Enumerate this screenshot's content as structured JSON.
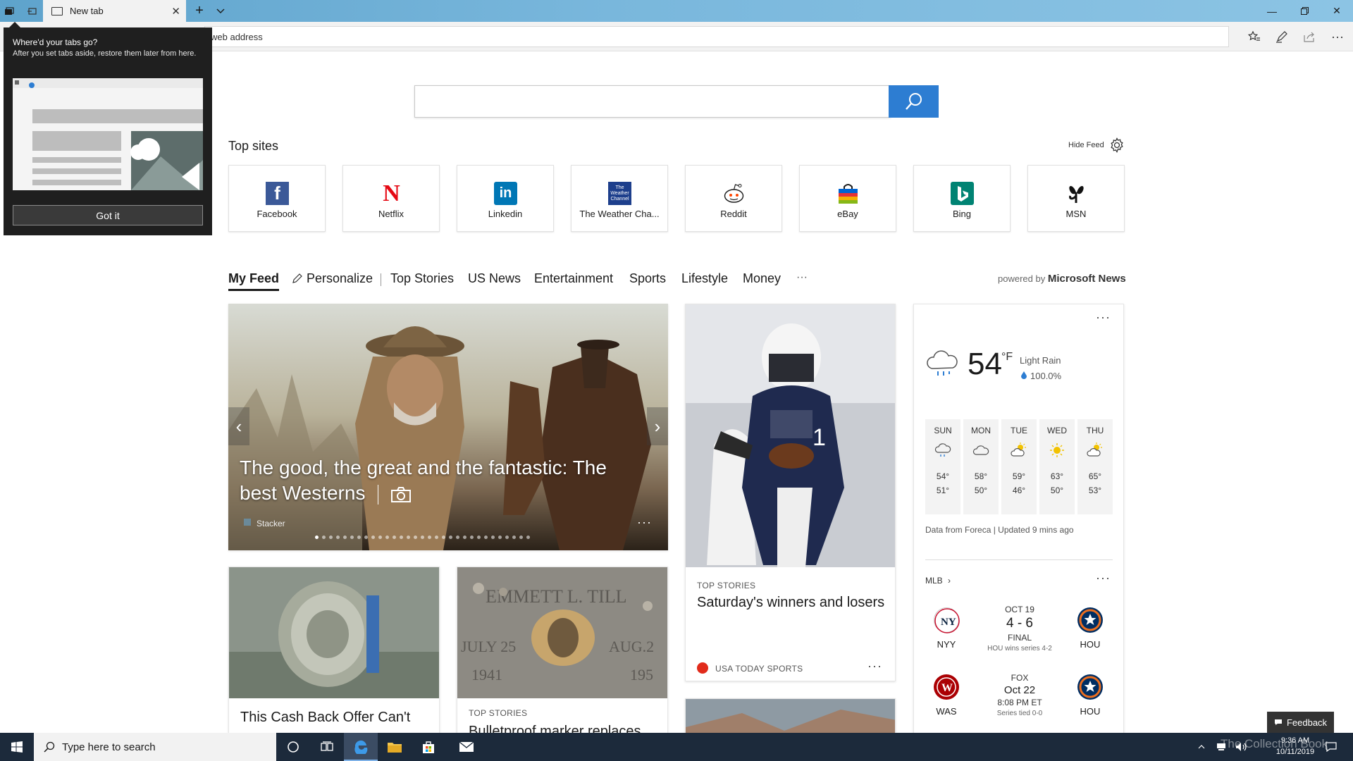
{
  "browser": {
    "tab_title": "New tab",
    "address_placeholder": "Search or enter web address",
    "address_visible": "web address"
  },
  "popup": {
    "title": "Where'd your tabs go?",
    "body": "After you set tabs aside, restore them later from here.",
    "button": "Got it"
  },
  "topsites": {
    "title": "Top sites",
    "hide_feed": "Hide Feed",
    "sites": [
      {
        "label": "Facebook",
        "icon": "facebook-icon",
        "color": "#3b5998"
      },
      {
        "label": "Netflix",
        "icon": "netflix-icon",
        "color": "#e50914"
      },
      {
        "label": "Linkedin",
        "icon": "linkedin-icon",
        "color": "#0077b5"
      },
      {
        "label": "The Weather Cha...",
        "icon": "weather-channel-icon",
        "color": "#1d3f8c"
      },
      {
        "label": "Reddit",
        "icon": "reddit-icon",
        "color": "#ff4500"
      },
      {
        "label": "eBay",
        "icon": "ebay-icon",
        "color": "#86b817"
      },
      {
        "label": "Bing",
        "icon": "bing-icon",
        "color": "#008373"
      },
      {
        "label": "MSN",
        "icon": "msn-icon",
        "color": "#111111"
      }
    ]
  },
  "feed_nav": {
    "items": [
      "My Feed",
      "Personalize",
      "Top Stories",
      "US News",
      "Entertainment",
      "Sports",
      "Lifestyle",
      "Money",
      "···"
    ],
    "powered_prefix": "powered by",
    "powered_brand": "Microsoft News"
  },
  "hero": {
    "title": "The good, the great and the fantastic: The best Westerns",
    "source": "Stacker",
    "more": "···"
  },
  "story_sports": {
    "label": "TOP STORIES",
    "title": "Saturday's winners and losers",
    "source": "USA TODAY SPORTS",
    "more": "···"
  },
  "story_cash": {
    "title": "This Cash Back Offer Can't"
  },
  "story_marker": {
    "label": "TOP STORIES",
    "title": "Bulletproof marker replaces"
  },
  "weather": {
    "temp": "54",
    "unit": "°F",
    "condition": "Light Rain",
    "precip": "100.0%",
    "more": "···",
    "forecast": [
      {
        "day": "SUN",
        "hi": "54°",
        "lo": "51°",
        "icon": "rain-cloud-icon"
      },
      {
        "day": "MON",
        "hi": "58°",
        "lo": "50°",
        "icon": "cloud-icon"
      },
      {
        "day": "TUE",
        "hi": "59°",
        "lo": "46°",
        "icon": "partly-sunny-icon"
      },
      {
        "day": "WED",
        "hi": "63°",
        "lo": "50°",
        "icon": "sun-icon"
      },
      {
        "day": "THU",
        "hi": "65°",
        "lo": "53°",
        "icon": "partly-sunny-icon"
      }
    ],
    "footer": "Data from Foreca | Updated 9 mins ago"
  },
  "mlb": {
    "title": "MLB",
    "more": "···",
    "games": [
      {
        "away": "NYY",
        "home": "HOU",
        "line1": "OCT 19",
        "score": "4 - 6",
        "status": "FINAL",
        "note": "HOU wins series 4-2"
      },
      {
        "away": "WAS",
        "home": "HOU",
        "line1": "FOX",
        "score": "Oct 22",
        "status": "8:08 PM ET",
        "note": "Series tied 0-0"
      }
    ]
  },
  "feedback": "Feedback",
  "taskbar": {
    "search_placeholder": "Type here to search",
    "time": "9:36 AM",
    "date": "10/11/2019"
  },
  "watermark": "The Collection Book",
  "colors": {
    "accent": "#2d7dd2",
    "taskbar": "#1c2a3b"
  }
}
